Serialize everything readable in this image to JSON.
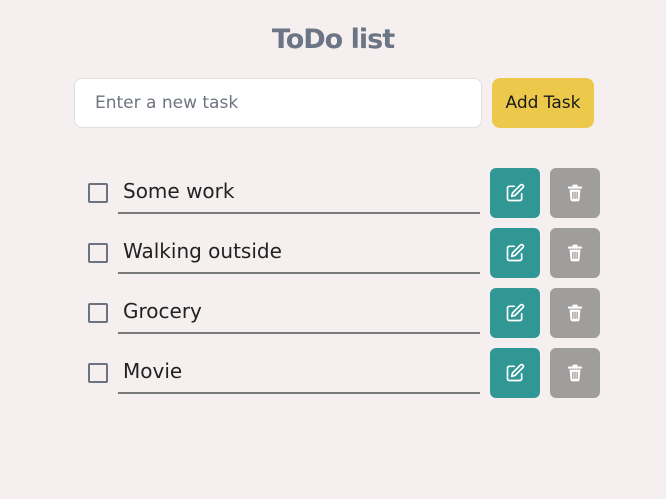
{
  "header": {
    "title": "ToDo list"
  },
  "new_task": {
    "value": "",
    "placeholder": "Enter a new task",
    "add_button_label": "Add Task"
  },
  "tasks": [
    {
      "text": "Some work",
      "completed": false
    },
    {
      "text": "Walking outside",
      "completed": false
    },
    {
      "text": "Grocery",
      "completed": false
    },
    {
      "text": "Movie",
      "completed": false
    }
  ],
  "icons": {
    "edit": "edit-icon",
    "delete": "trash-icon"
  },
  "colors": {
    "background": "#f5f0ef",
    "title": "#6b7585",
    "add_button": "#ecc94b",
    "edit_button": "#319795",
    "delete_button": "#a09e9c"
  }
}
